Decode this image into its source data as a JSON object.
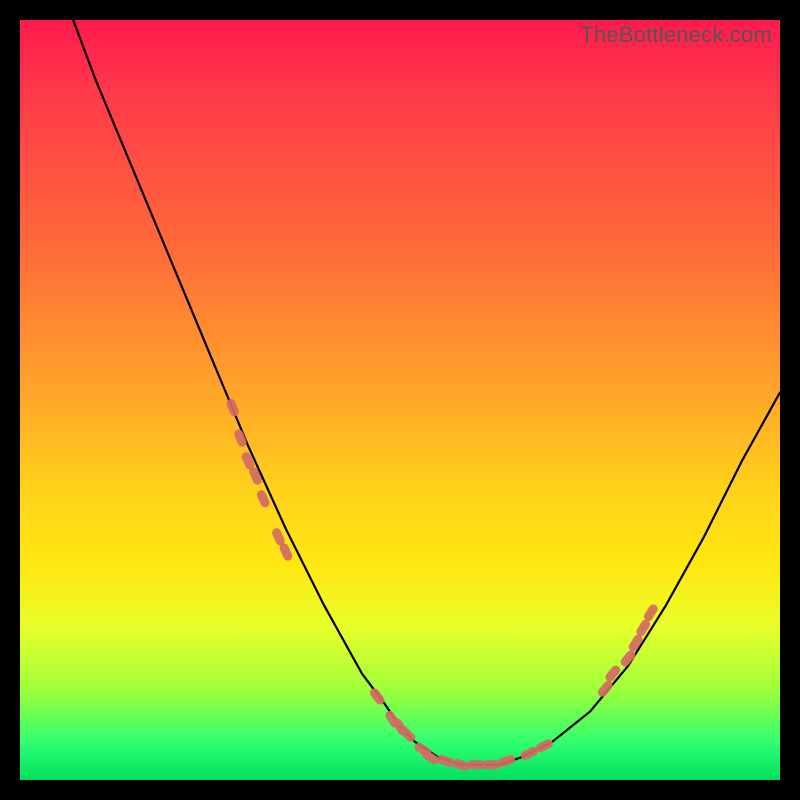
{
  "watermark": "TheBottleneck.com",
  "gradient_colors": {
    "top": "#ff1a4d",
    "upper_mid": "#ffa22a",
    "mid": "#ffe812",
    "lower_mid": "#a0ff3a",
    "bottom": "#00e060"
  },
  "chart_data": {
    "type": "line",
    "title": "",
    "xlabel": "",
    "ylabel": "",
    "xlim": [
      0,
      100
    ],
    "ylim": [
      0,
      100
    ],
    "grid": false,
    "legend": false,
    "series": [
      {
        "name": "bottleneck-curve",
        "x": [
          7,
          10,
          15,
          20,
          25,
          30,
          35,
          40,
          45,
          48,
          50,
          52,
          55,
          58,
          60,
          63,
          66,
          70,
          75,
          80,
          85,
          90,
          95,
          100
        ],
        "values": [
          100,
          92,
          80,
          68,
          56,
          44,
          33,
          23,
          14,
          10,
          7,
          5,
          3,
          2,
          2,
          2,
          3,
          5,
          9,
          15,
          23,
          32,
          42,
          51
        ]
      }
    ],
    "markers": [
      {
        "name": "left-cluster",
        "color": "#d46a63",
        "points": [
          {
            "x": 28,
            "y": 49
          },
          {
            "x": 29,
            "y": 45
          },
          {
            "x": 30,
            "y": 42
          },
          {
            "x": 31,
            "y": 40
          },
          {
            "x": 32,
            "y": 37
          },
          {
            "x": 34,
            "y": 32
          },
          {
            "x": 35,
            "y": 30
          }
        ]
      },
      {
        "name": "bottom-cluster",
        "color": "#d46a63",
        "points": [
          {
            "x": 47,
            "y": 11
          },
          {
            "x": 49,
            "y": 8
          },
          {
            "x": 50,
            "y": 7
          },
          {
            "x": 51,
            "y": 6
          },
          {
            "x": 53,
            "y": 4
          },
          {
            "x": 54,
            "y": 3
          },
          {
            "x": 56,
            "y": 2.5
          },
          {
            "x": 58,
            "y": 2
          },
          {
            "x": 60,
            "y": 2
          },
          {
            "x": 62,
            "y": 2
          },
          {
            "x": 64,
            "y": 2.5
          },
          {
            "x": 67,
            "y": 3.5
          },
          {
            "x": 69,
            "y": 4.5
          }
        ]
      },
      {
        "name": "right-cluster",
        "color": "#d46a63",
        "points": [
          {
            "x": 77,
            "y": 12
          },
          {
            "x": 78,
            "y": 14
          },
          {
            "x": 80,
            "y": 16
          },
          {
            "x": 81,
            "y": 18
          },
          {
            "x": 82,
            "y": 20
          },
          {
            "x": 83,
            "y": 22
          }
        ]
      }
    ]
  }
}
